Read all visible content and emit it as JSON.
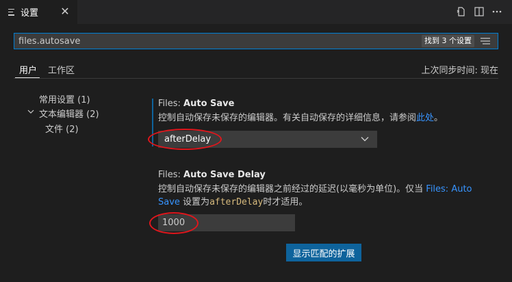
{
  "tab": {
    "title": "设置",
    "icon": "settings-tab-icon",
    "close_icon": "close-icon"
  },
  "toolbar": {
    "icons": [
      "open-settings-json-icon",
      "split-editor-icon",
      "more-actions-icon"
    ]
  },
  "search": {
    "value": "files.autosave",
    "result_count": "找到 3 个设置",
    "filter_icon": "filter-icon"
  },
  "scope": {
    "user": "用户",
    "workspace": "工作区",
    "sync_status": "上次同步时间: 现在"
  },
  "toc": {
    "items": [
      {
        "label": "常用设置 (1)"
      },
      {
        "label": "文本编辑器 (2)",
        "expanded": true
      },
      {
        "label": "文件 (2)"
      }
    ]
  },
  "settings": {
    "auto_save": {
      "category": "Files: ",
      "name": "Auto Save",
      "description": "控制自动保存未保存的编辑器。有关自动保存的详细信息，请参阅",
      "link": "此处",
      "description_end": "。",
      "value": "afterDelay"
    },
    "auto_save_delay": {
      "category": "Files: ",
      "name": "Auto Save Delay",
      "description_line1_a": "控制自动保存未保存的编辑器之前经过的延迟(以毫秒为单位)。仅当 ",
      "description_line1_link": "Files: Auto",
      "description_line2_link": "Save",
      "description_line2_a": " 设置为",
      "description_line2_code": "afterDelay",
      "description_line2_b": "时才适用。",
      "value": "1000"
    }
  },
  "show_extensions_button": "显示匹配的扩展",
  "colors": {
    "accent": "#0e639c",
    "focus_border": "#007fd4",
    "annotation": "#e0161c",
    "link": "#3794ff",
    "code": "#d7ba7d"
  }
}
